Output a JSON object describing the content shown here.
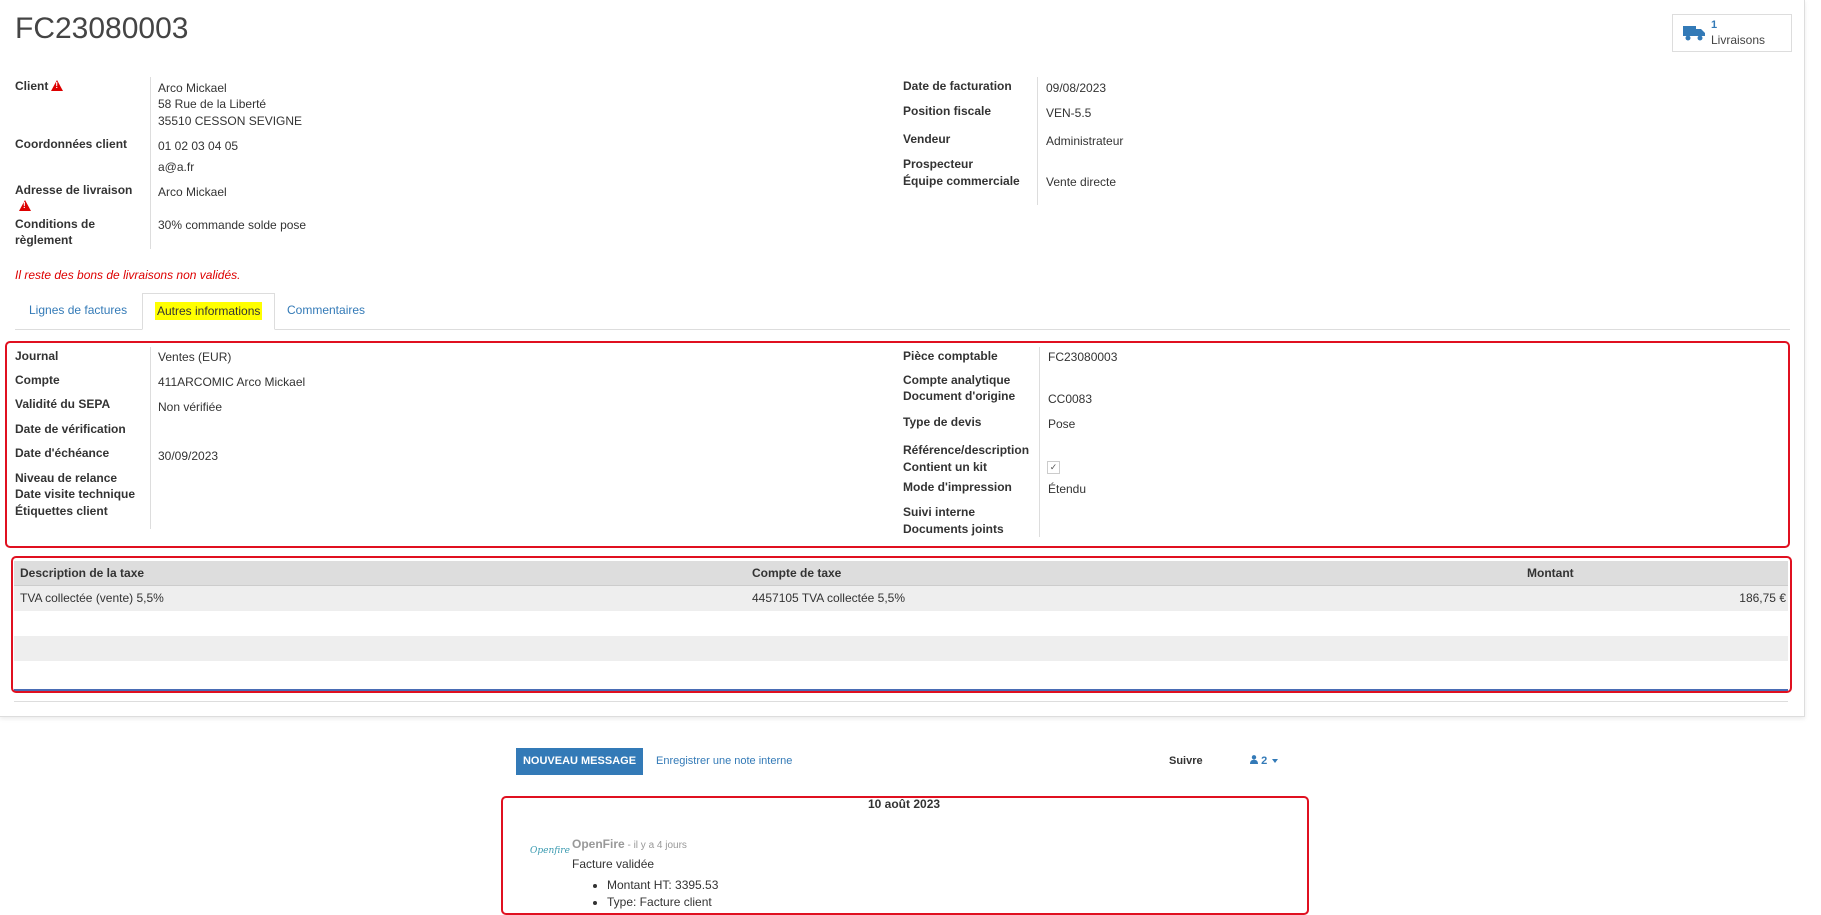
{
  "record": {
    "title": "FC23080003",
    "stat_button": {
      "count": "1",
      "label": "Livraisons",
      "icon": "truck-icon"
    }
  },
  "left_group": {
    "client_label": "Client",
    "client_name": "Arco Mickael",
    "client_street": "58 Rue de la Liberté",
    "client_city": "35510 CESSON SEVIGNE",
    "coords_label": "Coordonnées client",
    "phone": "01 02 03 04 05",
    "email": "a@a.fr",
    "delivery_label": "Adresse de livraison",
    "delivery_value": "Arco Mickael",
    "payment_label_1": "Conditions de",
    "payment_label_2": "règlement",
    "payment_value": "30% commande solde pose"
  },
  "right_group": {
    "date_label": "Date de facturation",
    "date_value": "09/08/2023",
    "fiscal_label": "Position fiscale",
    "fiscal_value": "VEN-5.5",
    "seller_label": "Vendeur",
    "seller_value": "Administrateur",
    "prospector_label": "Prospecteur",
    "team_label": "Équipe commerciale",
    "team_value": "Vente directe"
  },
  "warning_message": "Il reste des bons de livraisons non validés.",
  "tabs": [
    {
      "label": "Lignes de factures"
    },
    {
      "label": "Autres informations"
    },
    {
      "label": "Commentaires"
    }
  ],
  "other_info_left": {
    "journal_label": "Journal",
    "journal_value": "Ventes (EUR)",
    "account_label": "Compte",
    "account_value": "411ARCOMIC Arco Mickael",
    "sepa_label": "Validité du SEPA",
    "sepa_value": "Non vérifiée",
    "verif_label": "Date de vérification",
    "due_label": "Date d'échéance",
    "due_value": "30/09/2023",
    "reminder_label": "Niveau de relance",
    "visit_label": "Date visite technique",
    "tags_label": "Étiquettes client"
  },
  "other_info_right": {
    "move_label": "Pièce comptable",
    "move_value": "FC23080003",
    "analytic_label": "Compte analytique",
    "origin_label": "Document d'origine",
    "origin_value": "CC0083",
    "quote_type_label": "Type de devis",
    "quote_type_value": "Pose",
    "ref_label": "Référence/description",
    "kit_label": "Contient un kit",
    "kit_checked": "✓",
    "print_label": "Mode d'impression",
    "print_value": "Étendu",
    "followup_label": "Suivi interne",
    "docs_label": "Documents joints"
  },
  "tax_table": {
    "columns": [
      "Description de la taxe",
      "Compte de taxe",
      "Montant"
    ],
    "rows": [
      [
        "TVA collectée (vente) 5,5%",
        "4457105 TVA collectée 5,5%",
        "186,75 €"
      ]
    ]
  },
  "chatter": {
    "new_message": "NOUVEAU MESSAGE",
    "log_note": "Enregistrer une note interne",
    "follow": "Suivre",
    "followers_count": "2",
    "date_separator": "10 août 2023",
    "message": {
      "avatar_text": "Openfire",
      "author": "OpenFire",
      "time": " - il y a 4 jours",
      "body": "Facture validée",
      "items": [
        "Montant HT: 3395.53",
        "Type: Facture client"
      ]
    }
  },
  "colors": {
    "accent": "#337ab7",
    "highlight": "#ffff00",
    "annotation": "#e01020",
    "warning": "#dd0000"
  }
}
